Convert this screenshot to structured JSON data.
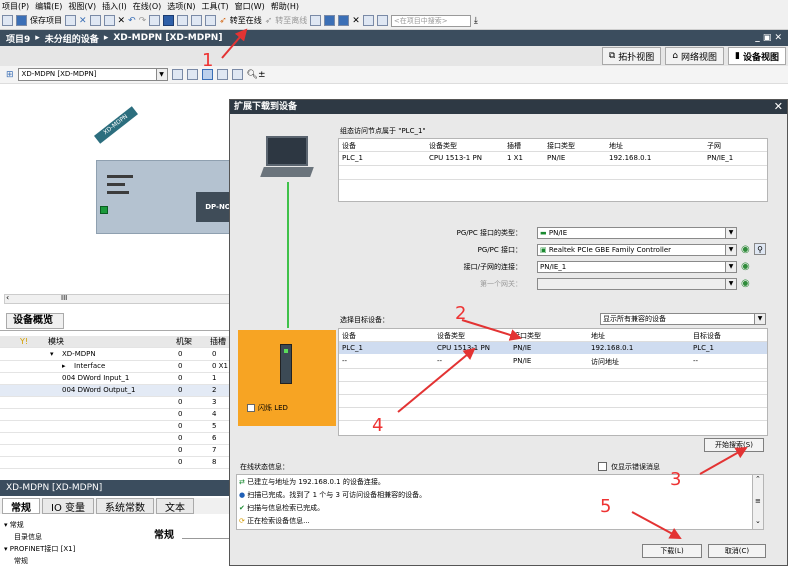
{
  "menubar": [
    "项目(P)",
    "编辑(E)",
    "视图(V)",
    "插入(I)",
    "在线(O)",
    "选项(N)",
    "工具(T)",
    "窗口(W)",
    "帮助(H)"
  ],
  "toolbar": {
    "save_project": "保存项目",
    "go_online": "转至在线",
    "go_offline": "转至离线",
    "search_placeholder": "<在项目中搜索>"
  },
  "breadcrumb": [
    "项目9",
    "未分组的设备",
    "XD-MDPN [XD-MDPN]"
  ],
  "view_tabs": {
    "topology": "拓扑视图",
    "network": "网络视图",
    "device": "设备视图"
  },
  "device_selector": "XD-MDPN [XD-MDPN]",
  "device": {
    "name": "XD-MDPN",
    "module": "DP-NO"
  },
  "overview": {
    "tab": "设备概览",
    "headers": {
      "module": "模块",
      "rack": "机架",
      "slot": "插槽"
    },
    "rows": [
      {
        "module": "XD-MDPN",
        "rack": "0",
        "slot": "0"
      },
      {
        "module": "Interface",
        "rack": "0",
        "slot": "0 X1"
      },
      {
        "module": "004 DWord Input_1",
        "rack": "0",
        "slot": "1"
      },
      {
        "module": "004 DWord Output_1",
        "rack": "0",
        "slot": "2"
      },
      {
        "module": "",
        "rack": "0",
        "slot": "3"
      },
      {
        "module": "",
        "rack": "0",
        "slot": "4"
      },
      {
        "module": "",
        "rack": "0",
        "slot": "5"
      },
      {
        "module": "",
        "rack": "0",
        "slot": "6"
      },
      {
        "module": "",
        "rack": "0",
        "slot": "7"
      },
      {
        "module": "",
        "rack": "0",
        "slot": "8"
      }
    ]
  },
  "props": {
    "title": "XD-MDPN [XD-MDPN]",
    "tabs": [
      "常规",
      "IO 变量",
      "系统常数",
      "文本"
    ],
    "tree": [
      "常规",
      "目录信息",
      "PROFINET接口 [X1]",
      "常规"
    ],
    "section": "常规"
  },
  "dialog": {
    "title": "扩展下载到设备",
    "config_caption": "组态访问节点属于 \"PLC_1\"",
    "config_headers": [
      "设备",
      "设备类型",
      "插槽",
      "接口类型",
      "地址",
      "子网"
    ],
    "config_row": [
      "PLC_1",
      "CPU 1513-1 PN",
      "1 X1",
      "PN/IE",
      "192.168.0.1",
      "PN/IE_1"
    ],
    "pgpc_type_label": "PG/PC 接口的类型：",
    "pgpc_type_value": "PN/IE",
    "pgpc_iface_label": "PG/PC 接口：",
    "pgpc_iface_value": "Realtek PCIe GBE Family Controller",
    "subnet_label": "接口/子网的连接：",
    "subnet_value": "PN/IE_1",
    "gateway_label": "第一个网关：",
    "target_label": "选择目标设备：",
    "target_filter": "显示所有兼容的设备",
    "target_headers": [
      "设备",
      "设备类型",
      "接口类型",
      "地址",
      "目标设备"
    ],
    "target_rows": [
      [
        "PLC_1",
        "CPU 1513-1 PN",
        "PN/IE",
        "192.168.0.1",
        "PLC_1"
      ],
      [
        "--",
        "--",
        "PN/IE",
        "访问地址",
        "--"
      ]
    ],
    "flash_led": "闪烁 LED",
    "search_button": "开始搜索(S)",
    "status_label": "在线状态信息：",
    "errors_only": "仅显示错误消息",
    "status_messages": [
      "已建立与地址为 192.168.0.1 的设备连接。",
      "扫描已完成。找到了 1 个与 3 可访问设备相兼容的设备。",
      "扫描与信息检索已完成。",
      "正在检索设备信息..."
    ],
    "download_button": "下载(L)",
    "cancel_button": "取消(C)"
  },
  "annotations": [
    "1",
    "2",
    "3",
    "4",
    "5"
  ],
  "colors": {
    "accent_red": "#e33333",
    "title_bar": "#3b4d5e",
    "selection": "#cfdcf0",
    "plc_panel": "#f7a423"
  }
}
